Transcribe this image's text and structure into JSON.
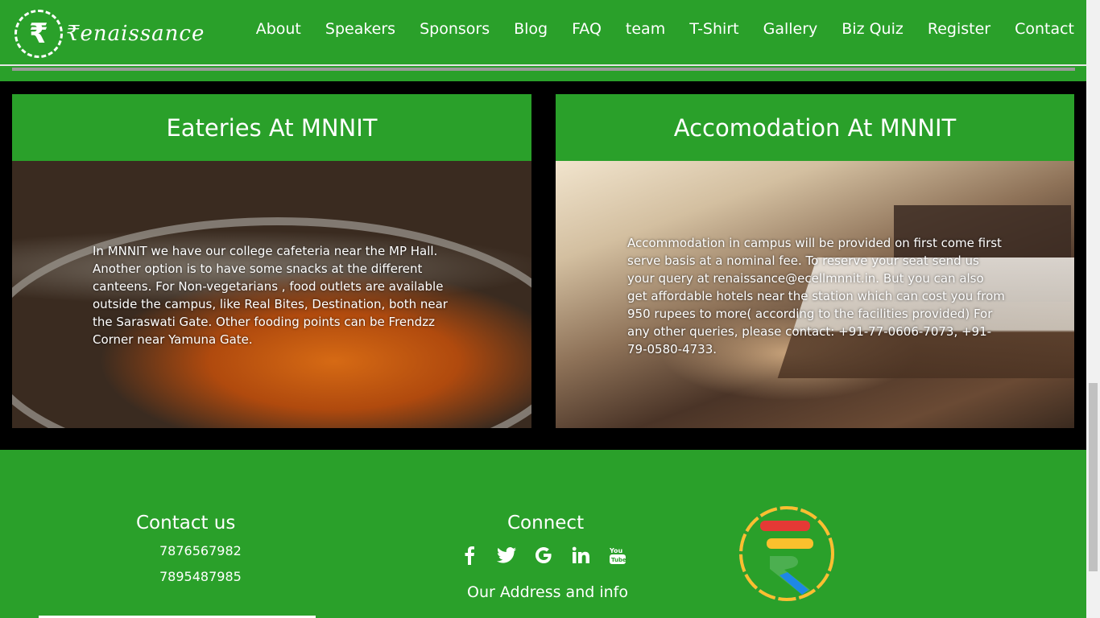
{
  "brand": {
    "logo_glyph": "₹",
    "name": "₹enaissance"
  },
  "nav": {
    "items": [
      "About",
      "Speakers",
      "Sponsors",
      "Blog",
      "FAQ",
      "team",
      "T-Shirt",
      "Gallery",
      "Biz Quiz",
      "Register",
      "Contact"
    ]
  },
  "cards": {
    "eateries": {
      "title": "Eateries At MNNIT",
      "text": "In MNNIT we have our college cafeteria near the MP Hall. Another option is to have some snacks at the different canteens. For Non-vegetarians , food outlets are available outside the campus, like Real Bites, Destination, both near the Saraswati Gate. Other fooding points can be Frendzz Corner near Yamuna Gate."
    },
    "accommodation": {
      "title": "Accomodation At MNNIT",
      "text": "Accommodation in campus will be provided on first come first serve basis at a nominal fee. To reserve your seat send us your query at renaissance@ecellmnnit.in. But you can also get affordable hotels near the station which can cost you from 950 rupees to more( according to the facilities provided) For any other queries, please contact: +91-77-0606-7073, +91-79-0580-4733."
    }
  },
  "footer": {
    "contact_title": "Contact us",
    "phones": [
      "7876567982",
      "7895487985"
    ],
    "connect_title": "Connect",
    "socials": [
      {
        "name": "facebook-icon",
        "glyph": "f"
      },
      {
        "name": "twitter-icon",
        "glyph": "🐦"
      },
      {
        "name": "google-icon",
        "glyph": "G"
      },
      {
        "name": "linkedin-icon",
        "glyph": "in"
      },
      {
        "name": "youtube-icon",
        "glyph": "▶"
      }
    ],
    "address_link": "Our Address and info",
    "logo_glyph": "₹"
  },
  "colors": {
    "brand_green": "#2aa02a",
    "background": "#000000"
  }
}
